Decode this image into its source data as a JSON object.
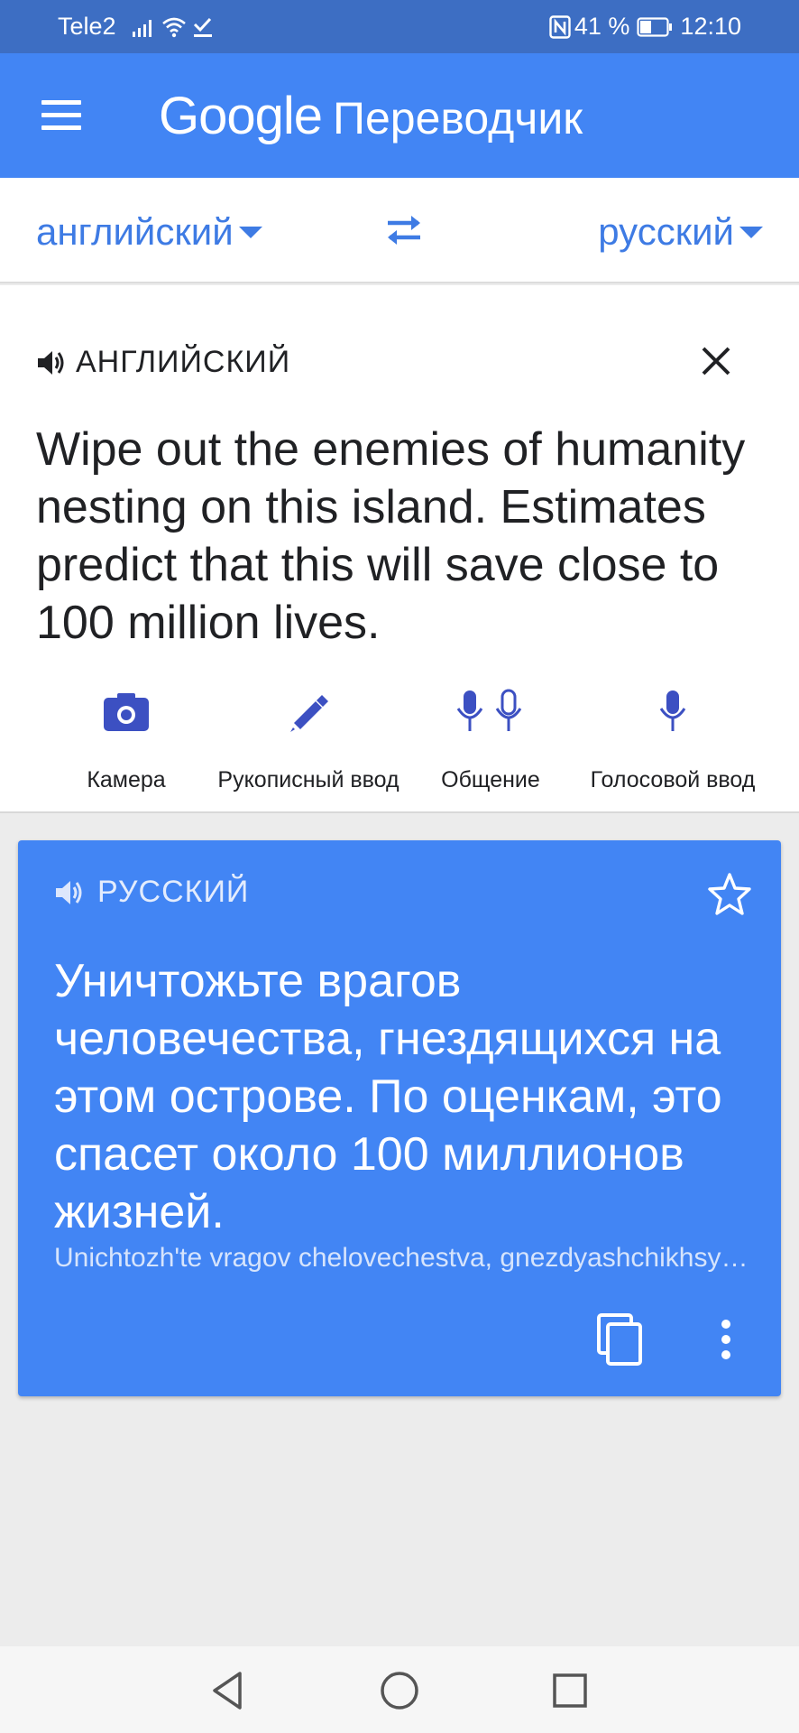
{
  "status_bar": {
    "carrier": "Tele2",
    "battery": "41 %",
    "time": "12:10",
    "icons": [
      "signal-icon",
      "wifi-icon",
      "check-icon",
      "nfc-icon",
      "battery-icon"
    ]
  },
  "app_bar": {
    "logo": "Google",
    "product": "Переводчик",
    "menu_icon": "menu-icon"
  },
  "languages": {
    "source": "английский",
    "target": "русский",
    "swap_icon": "swap-icon"
  },
  "input": {
    "language_label": "АНГЛИЙСКИЙ",
    "text": "Wipe out the enemies of humanity nesting on this island. Estimates predict that this will save close to 100 million lives.",
    "tools": [
      {
        "label": "Камера",
        "icon": "camera-icon"
      },
      {
        "label": "Рукописный ввод",
        "icon": "pen-icon"
      },
      {
        "label": "Общение",
        "icon": "conversation-icon"
      },
      {
        "label": "Голосовой ввод",
        "icon": "mic-icon"
      }
    ]
  },
  "output": {
    "language_label": "РУССКИЙ",
    "text": "Уничтожьте врагов человечества, гнездящихся на этом острове.  По оценкам, это спасет около 100 миллионов жизней.",
    "transliteration": "Unichtozh'te vragov chelovechestva, gnezdyashchikhsya na etom ostrove."
  },
  "colors": {
    "status_bar": "#3d6ec3",
    "app_bar": "#4285f4",
    "accent_text": "#3e7be4",
    "result_card": "#4285f4",
    "background": "#ececec"
  }
}
